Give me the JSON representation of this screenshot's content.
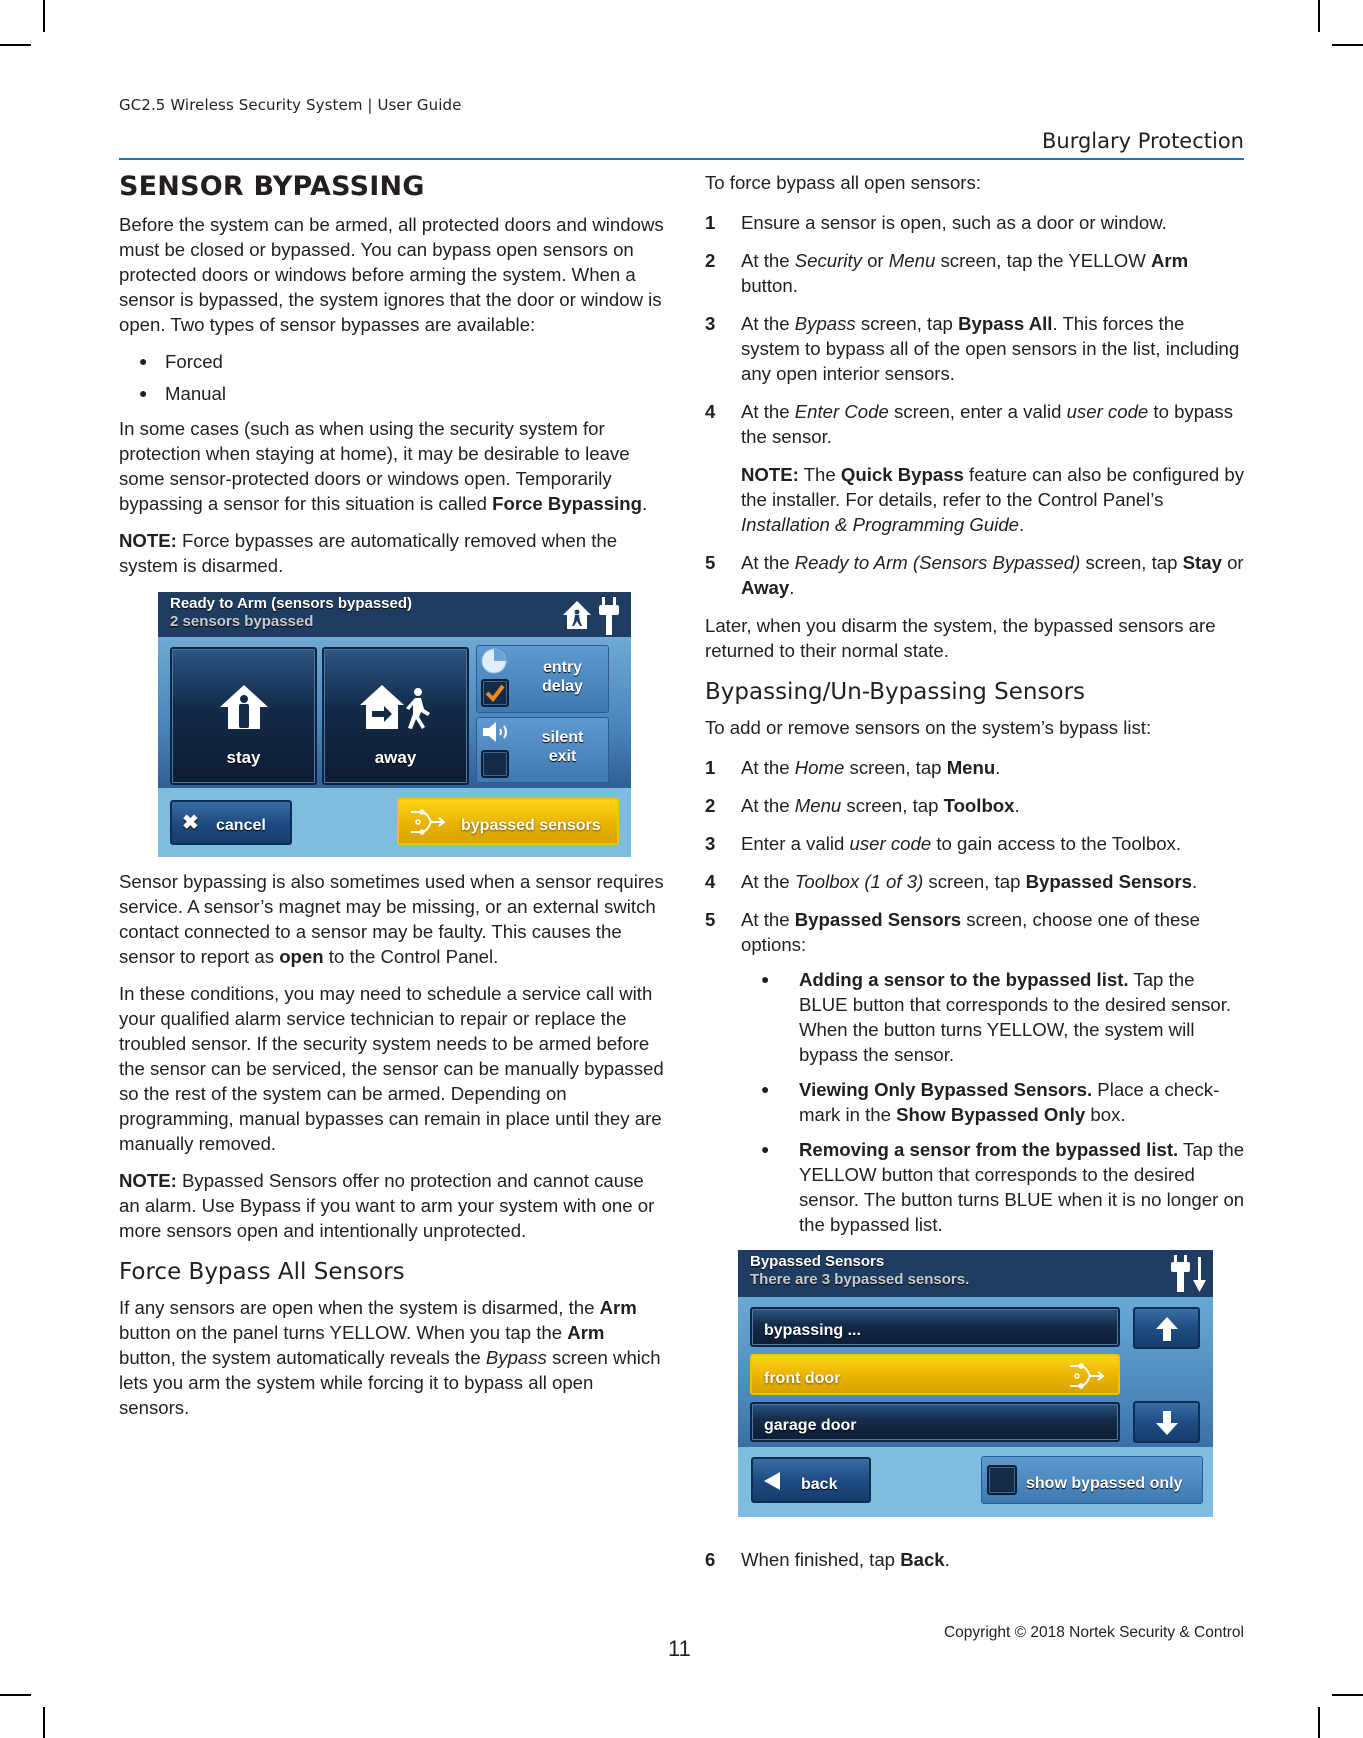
{
  "header": {
    "doc_title": "GC2.5 Wireless Security System | User Guide",
    "section_title": "Burglary Protection",
    "accent_color": "#1b75bc"
  },
  "left": {
    "title": "SENSOR BYPASSING",
    "intro": "Before the system can be armed, all protected doors and windows must be closed or bypassed. You can bypass open sensors on protected doors or windows before arming the system. When a sensor is bypassed, the system ignores that the door or window is open. Two types of sensor bypasses are available:",
    "bypass_types": [
      "Forced",
      "Manual"
    ],
    "para2_text": "In some cases (such as when using the security system for protection when staying at home), it may be desirable to leave some sensor-protected doors or windows open. Temporarily bypassing a sensor for this situation is called ",
    "para2_bold": "Force Bypassing",
    "para2_end": ".",
    "note1_label": "NOTE:",
    "note1_text": " Force bypasses are automatically removed when the system is disarmed.",
    "para3_text": "Sensor bypassing is also sometimes used when a sensor requires service. A sensor’s magnet may be missing, or an external switch contact connected to a sensor may be faulty. This causes the sensor to report as ",
    "para3_bold": "open",
    "para3_end": " to the Control Panel.",
    "para4": "In these conditions, you may need to schedule a service call with your qualified alarm service technician to repair or replace the troubled sensor. If the security system needs to be armed before the sensor can be serviced, the sensor can be manually bypassed so the rest of the system can be armed. Depending on programming, manual bypasses can remain in place until they are manually removed.",
    "note2_label": "NOTE:",
    "note2_text": " Bypassed Sensors offer no protection and cannot cause an alarm. Use Bypass if you want to arm your system with one or more sensors open and intentionally unprotected.",
    "subhead": "Force Bypass All Sensors",
    "para5_a": "If any sensors are open when the system is disarmed, the ",
    "para5_b": "Arm",
    "para5_c": " button on the panel turns YELLOW. When you tap the ",
    "para5_d": "Arm",
    "para5_e": " button, the system automatically reveals the ",
    "para5_f": "Bypass",
    "para5_g": " screen which lets you arm the system while forcing it to bypass all open sensors."
  },
  "arm_panel": {
    "title": "Ready to Arm (sensors bypassed)",
    "subtitle": "2 sensors bypassed",
    "stay_label": "stay",
    "away_label": "away",
    "entry_delay_line1": "entry",
    "entry_delay_line2": "delay",
    "entry_delay_checked": true,
    "silent_exit_line1": "silent",
    "silent_exit_line2": "exit",
    "silent_exit_checked": false,
    "cancel_label": "cancel",
    "bypassed_sensors_label": "bypassed sensors"
  },
  "right": {
    "intro": "To force bypass all open sensors:",
    "steps": [
      {
        "num": "1",
        "text": "Ensure a sensor is open, such as a door or window."
      },
      {
        "num": "2",
        "a": "At the ",
        "b": "Security",
        "c": " or ",
        "d": "Menu",
        "e": " screen, tap the YELLOW ",
        "f": "Arm",
        "g": " button."
      },
      {
        "num": "3",
        "a": "At the ",
        "b": "Bypass",
        "c": " screen, tap ",
        "d": "Bypass All",
        "e": ". This forces the system to bypass all of the open sensors in the list, including any open interior sensors."
      },
      {
        "num": "4",
        "a": "At the ",
        "b": "Enter Code",
        "c": " screen, enter a valid ",
        "d": "user code",
        "e": " to bypass the sensor."
      },
      {
        "num": "5",
        "a": "At the ",
        "b": "Ready to Arm (Sensors Bypassed)",
        "c": " screen, tap ",
        "d": "Stay",
        "e": " or ",
        "f": "Away",
        "g": "."
      }
    ],
    "note": {
      "label": "NOTE:",
      "a": " The ",
      "b": "Quick Bypass",
      "c": " feature can also be configured by the installer. For details, refer to the Control Panel’s ",
      "d": "Installation & Programming Guide",
      "e": "."
    },
    "later": "Later, when you disarm the system, the bypassed sensors are returned to their normal state.",
    "subhead": "Bypassing/Un-Bypassing Sensors",
    "intro2": "To add or remove sensors on the system’s bypass list:",
    "steps2": [
      {
        "num": "1",
        "a": "At the ",
        "b": "Home",
        "c": " screen, tap ",
        "d": "Menu",
        "e": "."
      },
      {
        "num": "2",
        "a": "At the ",
        "b": "Menu",
        "c": " screen, tap ",
        "d": "Toolbox",
        "e": "."
      },
      {
        "num": "3",
        "a": "Enter a valid ",
        "b": "user code",
        "c": " to gain access to the Toolbox."
      },
      {
        "num": "4",
        "a": "At the ",
        "b": "Toolbox (1 of 3)",
        "c": " screen, tap ",
        "d": "Bypassed Sensors",
        "e": "."
      },
      {
        "num": "5",
        "a": "At the ",
        "b": "Bypassed Sensors",
        "c": " screen, choose one of these options:"
      }
    ],
    "options": [
      {
        "bold": "Adding a sensor to the bypassed list.",
        "text": " Tap the BLUE button that corresponds to the desired sensor. When the button turns YELLOW, the system will bypass the sensor."
      },
      {
        "bold": "Viewing Only Bypassed Sensors.",
        "text_a": " Place a check-mark in the ",
        "bold2": "Show Bypassed Only",
        "text_b": " box."
      },
      {
        "bold": "Removing a sensor from the bypassed list.",
        "text": " Tap the YELLOW button that corresponds to the desired sensor. The button turns BLUE when it is no longer on the bypassed list."
      }
    ],
    "step6": {
      "num": "6",
      "a": "When finished, tap ",
      "b": "Back",
      "c": "."
    }
  },
  "bypass_panel": {
    "title": "Bypassed Sensors",
    "subtitle": "There are 3 bypassed sensors.",
    "sensors": [
      {
        "label": "bypassing ...",
        "bypassed": false
      },
      {
        "label": "front door",
        "bypassed": true
      },
      {
        "label": "garage door",
        "bypassed": false
      }
    ],
    "back_label": "back",
    "show_bypassed_label": "show bypassed only",
    "show_bypassed_checked": false
  },
  "footer": {
    "page_number": "11",
    "copyright": "Copyright ©  2018 Nortek Security & Control"
  }
}
